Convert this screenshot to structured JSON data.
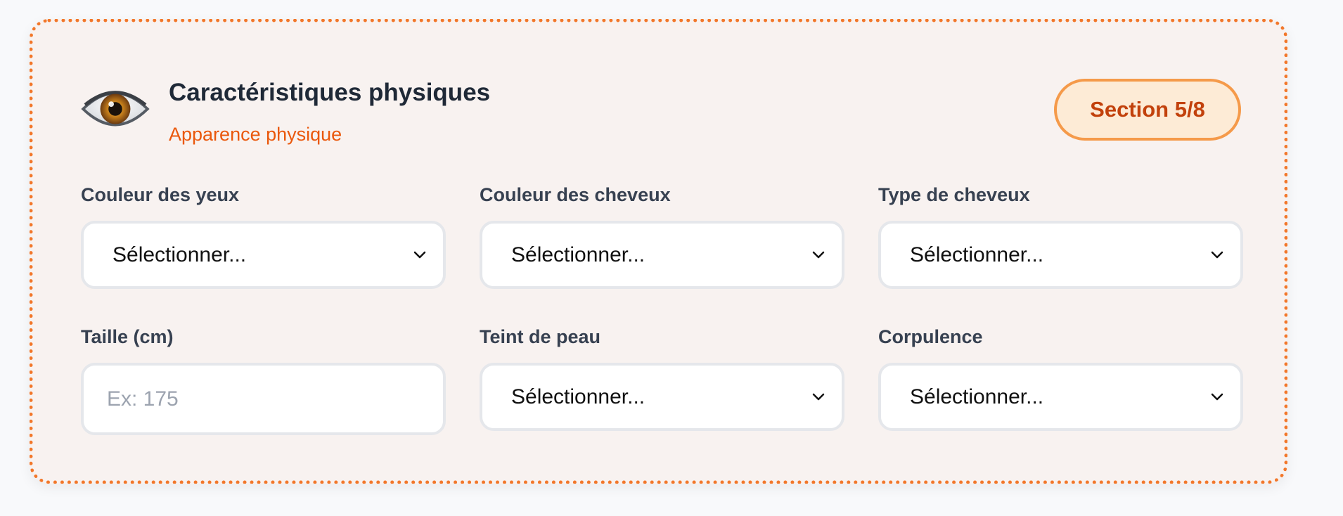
{
  "section": {
    "icon": "eye-icon",
    "title": "Caractéristiques physiques",
    "subtitle": "Apparence physique",
    "badge": "Section 5/8"
  },
  "fields": {
    "eye_color": {
      "label": "Couleur des yeux",
      "value": "Sélectionner..."
    },
    "hair_color": {
      "label": "Couleur des cheveux",
      "value": "Sélectionner..."
    },
    "hair_type": {
      "label": "Type de cheveux",
      "value": "Sélectionner..."
    },
    "height": {
      "label": "Taille (cm)",
      "value": "",
      "placeholder": "Ex: 175"
    },
    "skin_tone": {
      "label": "Teint de peau",
      "value": "Sélectionner..."
    },
    "build": {
      "label": "Corpulence",
      "value": "Sélectionner..."
    }
  },
  "colors": {
    "accent": "#f2772a",
    "subtitle": "#ea580c",
    "badge_text": "#c2410c",
    "badge_bg": "#fdebd6",
    "card_bg": "#f8f2f0"
  }
}
